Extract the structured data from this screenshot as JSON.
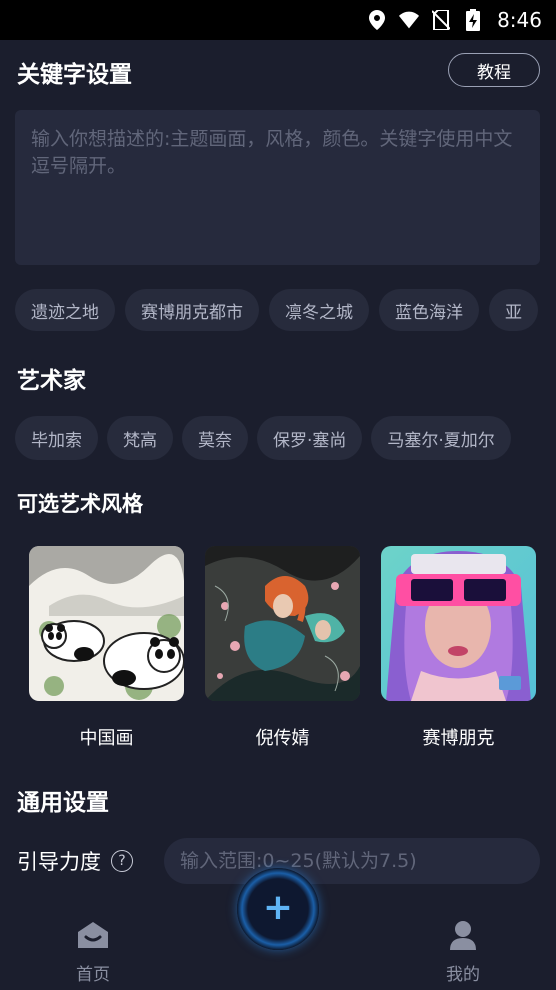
{
  "status_bar": {
    "time": "8:46"
  },
  "keywords": {
    "title": "关键字设置",
    "tutorial_label": "教程",
    "placeholder": "输入你想描述的:主题画面，风格，颜色。关键字使用中文逗号隔开。",
    "value": "",
    "chips": [
      "遗迹之地",
      "赛博朋克都市",
      "凛冬之城",
      "蓝色海洋",
      "亚"
    ]
  },
  "artists": {
    "title": "艺术家",
    "chips": [
      "毕加索",
      "梵高",
      "莫奈",
      "保罗·塞尚",
      "马塞尔·夏加尔"
    ]
  },
  "styles": {
    "title": "可选艺术风格",
    "items": [
      {
        "label": "中国画",
        "icon": "panda-ink-painting"
      },
      {
        "label": "倪传婧",
        "icon": "illustrated-figures-painting"
      },
      {
        "label": "赛博朋克",
        "icon": "cyberpunk-portrait"
      }
    ]
  },
  "general": {
    "title": "通用设置",
    "guide_label": "引导力度",
    "guide_placeholder": "输入范围:0~25(默认为7.5)",
    "guide_value": ""
  },
  "nav": {
    "home_label": "首页",
    "profile_label": "我的",
    "add_icon": "plus-icon"
  },
  "colors": {
    "background": "#1b1e2d",
    "surface": "#262a3d",
    "chip": "#272b3c",
    "accent": "#5fb4f5"
  }
}
